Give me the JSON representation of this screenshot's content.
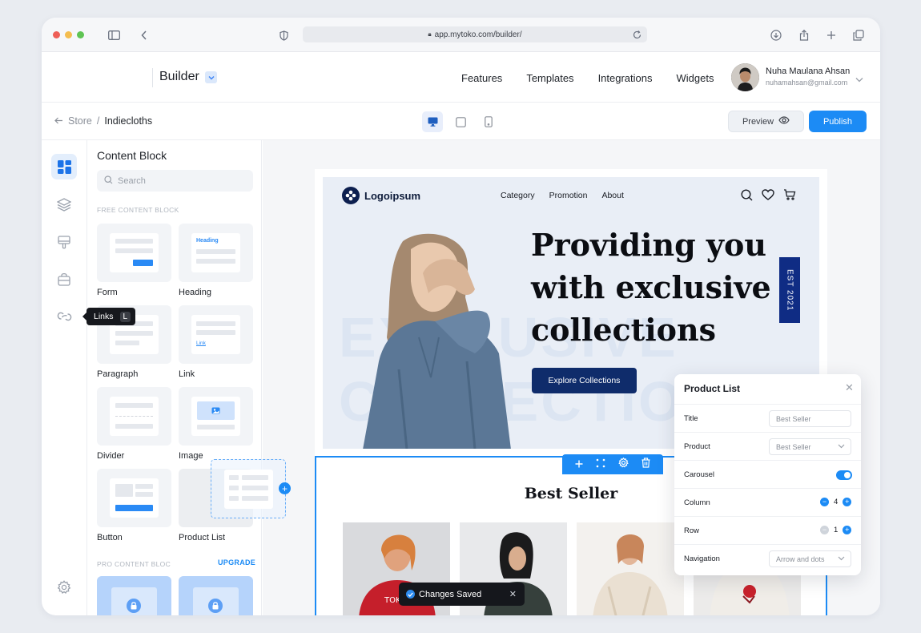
{
  "browser": {
    "url": "app.mytoko.com/builder/",
    "traffic_lights": [
      "#ee5f57",
      "#f4bd4f",
      "#5fc454"
    ]
  },
  "header": {
    "brand": "Builder",
    "nav": [
      "Features",
      "Templates",
      "Integrations",
      "Widgets"
    ],
    "user": {
      "name": "Nuha Maulana Ahsan",
      "email": "nuhamahsan@gmail.com"
    }
  },
  "subbar": {
    "breadcrumb": {
      "parent": "Store",
      "separator": "/",
      "current": "Indiecloths"
    },
    "devices": [
      "desktop-icon",
      "tablet-icon",
      "mobile-icon"
    ],
    "active_device": "desktop",
    "preview_label": "Preview",
    "publish_label": "Publish"
  },
  "rail": {
    "items": [
      "layout-grid-icon",
      "layers-icon",
      "brush-icon",
      "bag-icon",
      "link-icon"
    ],
    "active": "layout-grid-icon",
    "tooltip": {
      "label": "Links",
      "shortcut": "L"
    }
  },
  "panel": {
    "title": "Content Block",
    "search_placeholder": "Search",
    "free_label": "FREE CONTENT BLOCK",
    "blocks": [
      "Form",
      "Heading",
      "Paragraph",
      "Link",
      "Divider",
      "Image",
      "Button",
      "Product List"
    ],
    "heading_thumb_text": "Heading",
    "link_thumb_text": "Link",
    "pro_label": "PRO CONTENT  BLOC",
    "upgrade_label": "UPGRADE"
  },
  "site": {
    "logo": "Logoipsum",
    "nav": [
      "Category",
      "Promotion",
      "About"
    ],
    "icons": [
      "search-icon",
      "heart-icon",
      "cart-icon"
    ],
    "hero_title": "Providing you with exclusive collections",
    "hero_bg_text": [
      "EXCLUSIVE",
      "COLLECTIONS"
    ],
    "hero_cta": "Explore Collections",
    "badge": "EST 2021",
    "section_title": "Best Seller"
  },
  "props_panel": {
    "title": "Product List",
    "rows": {
      "title_label": "Title",
      "title_placeholder": "Best Seller",
      "product_label": "Product",
      "product_value": "Best Seller",
      "carousel_label": "Carousel",
      "carousel_on": true,
      "column_label": "Column",
      "column_value": "4",
      "row_label": "Row",
      "row_value": "1",
      "navigation_label": "Navigation",
      "navigation_value": "Arrow and dots"
    }
  },
  "toast": {
    "text": "Changes Saved"
  },
  "colors": {
    "accent": "#1c8bf5",
    "navy": "#0f2c6b",
    "hero_bg": "#e9eef6"
  }
}
